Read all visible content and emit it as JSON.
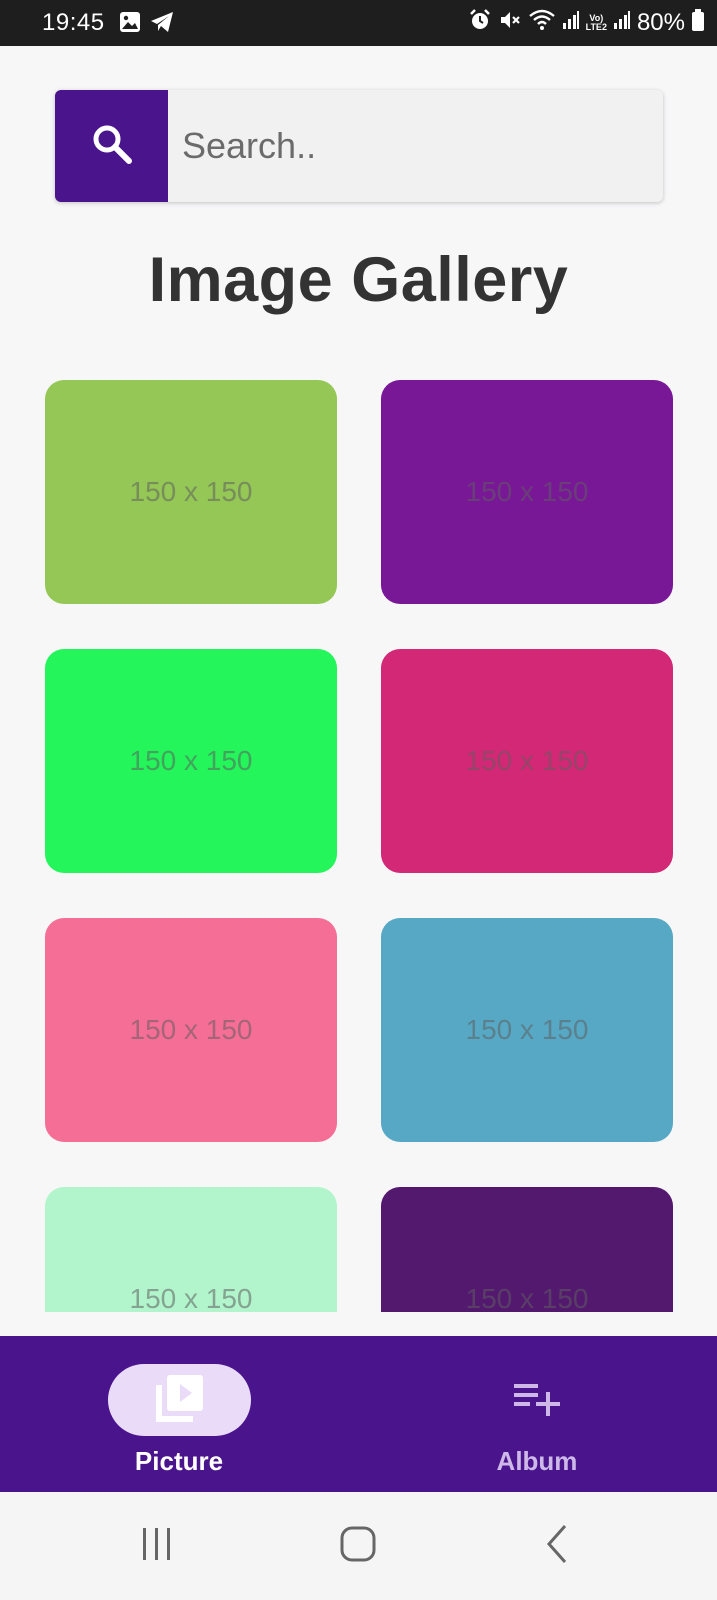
{
  "status_bar": {
    "time": "19:45",
    "battery": "80%",
    "lte_label_top": "Vo)",
    "lte_label_bottom": "LTE2",
    "icons": [
      "image-icon",
      "telegram-icon",
      "alarm-icon",
      "mute-icon",
      "wifi-icon",
      "signal-icon",
      "signal-icon",
      "battery-icon"
    ]
  },
  "search": {
    "placeholder": "Search..",
    "value": ""
  },
  "page_title": "Image Gallery",
  "gallery": {
    "items": [
      {
        "label": "150 x 150",
        "color": "#94c756"
      },
      {
        "label": "150 x 150",
        "color": "#781897"
      },
      {
        "label": "150 x 150",
        "color": "#23f55b"
      },
      {
        "label": "150 x 150",
        "color": "#d32875"
      },
      {
        "label": "150 x 150",
        "color": "#f56e96"
      },
      {
        "label": "150 x 150",
        "color": "#57a8c5"
      },
      {
        "label": "150 x 150",
        "color": "#b2f5cc"
      },
      {
        "label": "150 x 150",
        "color": "#53196f"
      }
    ]
  },
  "bottom_nav": {
    "items": [
      {
        "label": "Picture",
        "icon": "video-library-icon",
        "active": true
      },
      {
        "label": "Album",
        "icon": "playlist-add-icon",
        "active": false
      }
    ]
  },
  "colors": {
    "primary": "#4a148c",
    "active_pill": "#eadcf8",
    "title_text": "#333333"
  }
}
